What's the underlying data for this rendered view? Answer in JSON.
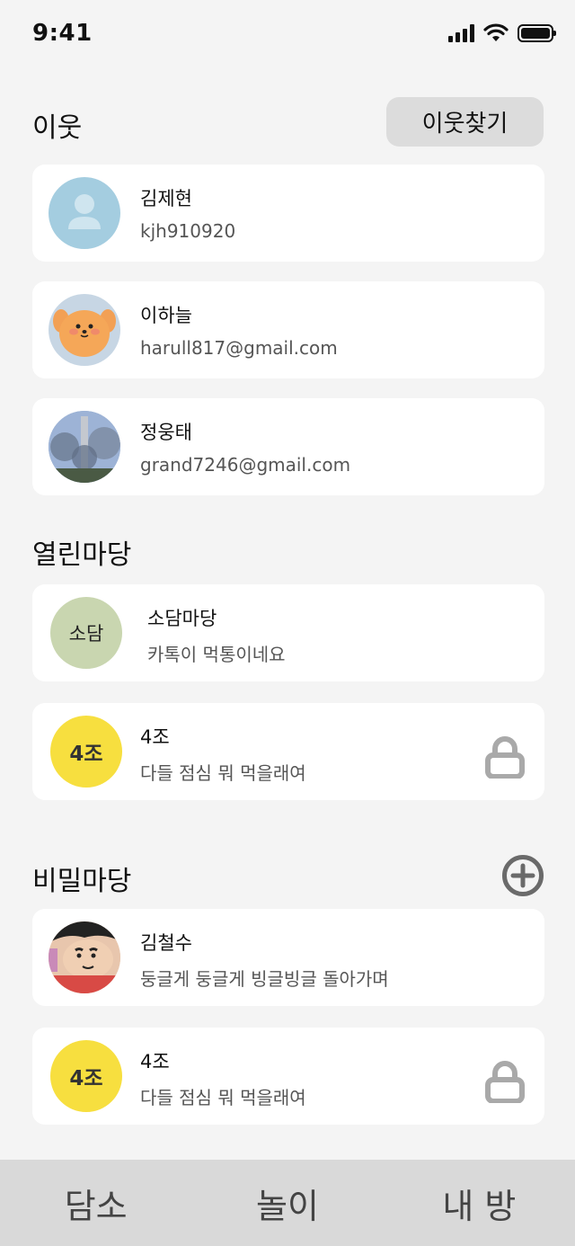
{
  "status_bar": {
    "time": "9:41"
  },
  "neighbors": {
    "title": "이웃",
    "find_button": "이웃찾기",
    "items": [
      {
        "name": "김제현",
        "id": "kjh910920",
        "avatar": "default-person"
      },
      {
        "name": "이하늘",
        "id": "harull817@gmail.com",
        "avatar": "bear-character"
      },
      {
        "name": "정웅태",
        "id": "grand7246@gmail.com",
        "avatar": "tree-photo"
      }
    ]
  },
  "open_rooms": {
    "title": "열린마당",
    "items": [
      {
        "avatar_text": "소담",
        "name": "소담마당",
        "message": "카톡이 먹통이네요",
        "avatar_color": "#c9d6b0",
        "locked": false
      },
      {
        "avatar_text": "4조",
        "name": "4조",
        "message": "다들 점심 뭐 먹을래여",
        "avatar_color": "#f7df3f",
        "locked": true
      }
    ]
  },
  "secret_rooms": {
    "title": "비밀마당",
    "add_icon": "plus-circle-icon",
    "items": [
      {
        "name": "김철수",
        "message": "둥글게 둥글게 빙글빙글 돌아가며",
        "avatar": "cartoon-boy",
        "locked": false
      },
      {
        "avatar_text": "4조",
        "name": "4조",
        "message": "다들 점심 뭐 먹을래여",
        "avatar_color": "#f7df3f",
        "locked": true
      }
    ]
  },
  "bottom_nav": {
    "items": [
      "담소",
      "놀이",
      "내 방"
    ]
  }
}
